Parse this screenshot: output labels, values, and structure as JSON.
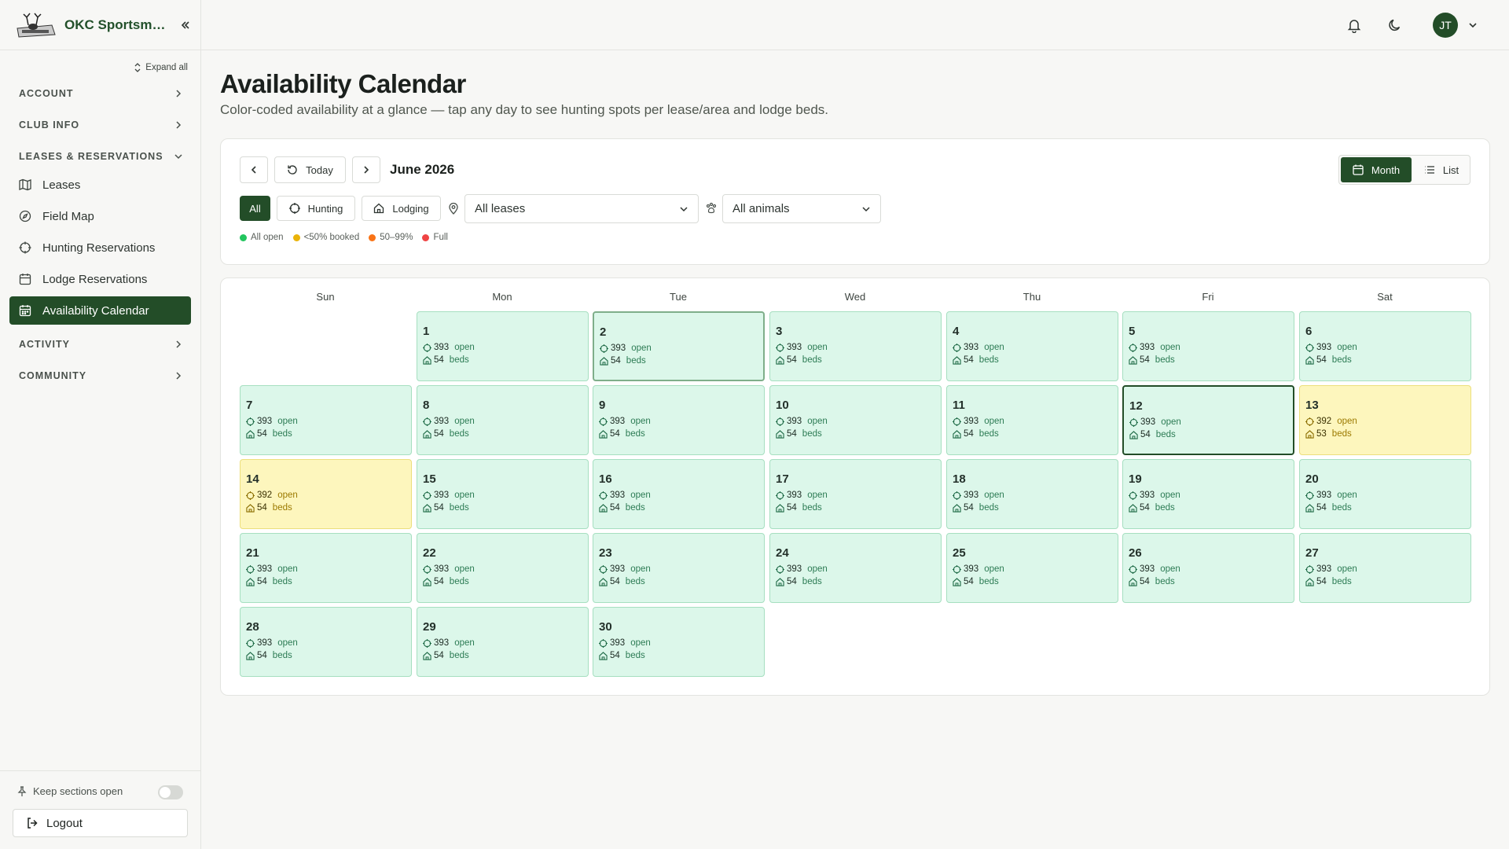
{
  "brand": {
    "name": "OKC Sportsma..."
  },
  "sidebar": {
    "expand_all": "Expand all",
    "sections": {
      "account": "ACCOUNT",
      "club_info": "CLUB INFO",
      "leases": "LEASES & RESERVATIONS",
      "activity": "ACTIVITY",
      "community": "COMMUNITY"
    },
    "items": {
      "leases": "Leases",
      "field_map": "Field Map",
      "hunting": "Hunting Reservations",
      "lodge": "Lodge Reservations",
      "calendar": "Availability Calendar"
    },
    "keep_open": "Keep sections open",
    "logout": "Logout"
  },
  "header": {
    "avatar_initials": "JT"
  },
  "page": {
    "title": "Availability Calendar",
    "subtitle": "Color-coded availability at a glance — tap any day to see hunting spots per lease/area and lodge beds."
  },
  "toolbar": {
    "today": "Today",
    "month_label": "June 2026",
    "view_month": "Month",
    "view_list": "List",
    "filter_all": "All",
    "filter_hunting": "Hunting",
    "filter_lodging": "Lodging",
    "lease_select": "All leases",
    "animal_select": "All animals"
  },
  "legend": {
    "all_open": "All open",
    "under50": "<50% booked",
    "range": "50–99%",
    "full": "Full",
    "colors": {
      "all_open": "#22c55e",
      "under50": "#eab308",
      "range": "#f97316",
      "full": "#ef4444"
    }
  },
  "calendar": {
    "weekdays": [
      "Sun",
      "Mon",
      "Tue",
      "Wed",
      "Thu",
      "Fri",
      "Sat"
    ],
    "open_unit": "open",
    "beds_unit": "beds",
    "days": [
      {
        "d": "1",
        "open": "393",
        "beds": "54"
      },
      {
        "d": "2",
        "open": "393",
        "beds": "54"
      },
      {
        "d": "3",
        "open": "393",
        "beds": "54"
      },
      {
        "d": "4",
        "open": "393",
        "beds": "54"
      },
      {
        "d": "5",
        "open": "393",
        "beds": "54"
      },
      {
        "d": "6",
        "open": "393",
        "beds": "54"
      },
      {
        "d": "7",
        "open": "393",
        "beds": "54"
      },
      {
        "d": "8",
        "open": "393",
        "beds": "54"
      },
      {
        "d": "9",
        "open": "393",
        "beds": "54"
      },
      {
        "d": "10",
        "open": "393",
        "beds": "54"
      },
      {
        "d": "11",
        "open": "393",
        "beds": "54"
      },
      {
        "d": "12",
        "open": "393",
        "beds": "54"
      },
      {
        "d": "13",
        "open": "392",
        "beds": "53"
      },
      {
        "d": "14",
        "open": "392",
        "beds": "54"
      },
      {
        "d": "15",
        "open": "393",
        "beds": "54"
      },
      {
        "d": "16",
        "open": "393",
        "beds": "54"
      },
      {
        "d": "17",
        "open": "393",
        "beds": "54"
      },
      {
        "d": "18",
        "open": "393",
        "beds": "54"
      },
      {
        "d": "19",
        "open": "393",
        "beds": "54"
      },
      {
        "d": "20",
        "open": "393",
        "beds": "54"
      },
      {
        "d": "21",
        "open": "393",
        "beds": "54"
      },
      {
        "d": "22",
        "open": "393",
        "beds": "54"
      },
      {
        "d": "23",
        "open": "393",
        "beds": "54"
      },
      {
        "d": "24",
        "open": "393",
        "beds": "54"
      },
      {
        "d": "25",
        "open": "393",
        "beds": "54"
      },
      {
        "d": "26",
        "open": "393",
        "beds": "54"
      },
      {
        "d": "27",
        "open": "393",
        "beds": "54"
      },
      {
        "d": "28",
        "open": "393",
        "beds": "54"
      },
      {
        "d": "29",
        "open": "393",
        "beds": "54"
      },
      {
        "d": "30",
        "open": "393",
        "beds": "54"
      }
    ]
  }
}
